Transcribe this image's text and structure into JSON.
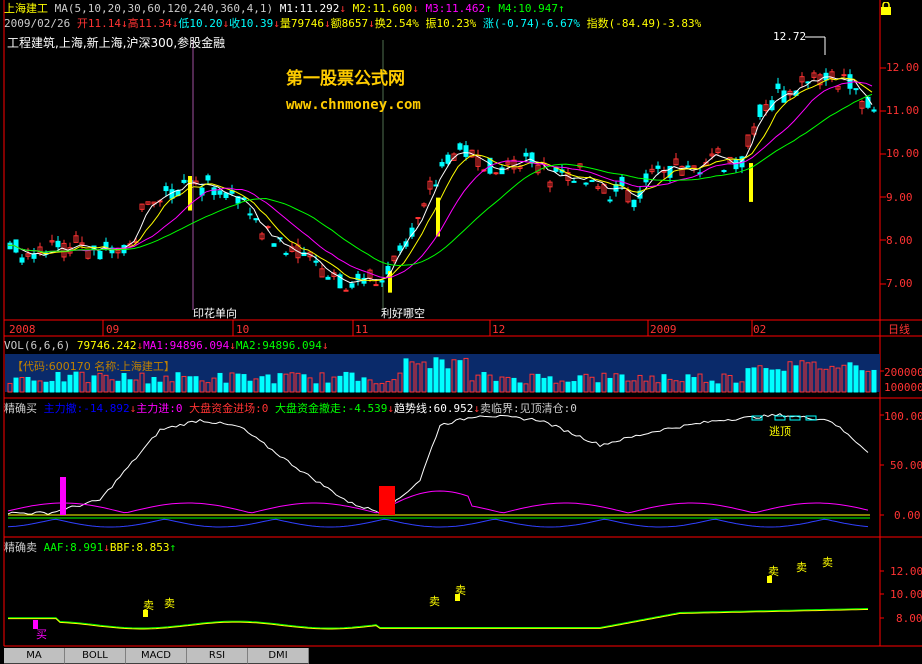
{
  "colors": {
    "up": "#ff3333",
    "down": "#00ffff",
    "ma5": "#ffffff",
    "ma10": "#ffff00",
    "ma20": "#ff00ff",
    "ma30": "#00ff00",
    "grid": "#800000",
    "axis": "#ff0000",
    "yellow": "#ffff00"
  },
  "header": {
    "stock_name": "上海建工",
    "ma_params": "MA(5,10,20,30,60,120,240,360,4,1)",
    "m1": "M1:11.292",
    "m2": "M2:11.600",
    "m3": "M3:11.462",
    "m4": "M4:10.947",
    "date": "2009/02/26",
    "open": "开11.14",
    "high": "高11.34",
    "low": "低10.20",
    "close": "收10.39",
    "volume": "量79746",
    "amount": "额8657",
    "turnover": "换2.54%",
    "amplitude": "振10.23%",
    "change": "涨(-0.74)-6.67%",
    "index": "指数(-84.49)-3.83%",
    "concepts": "工程建筑,上海,新上海,沪深300,参股金融"
  },
  "watermark": {
    "title": "第一股票公式网",
    "url": "www.chnmoney.com"
  },
  "price_panel": {
    "y_ticks": [
      "12.00",
      "11.00",
      "10.00",
      "9.00",
      "8.00",
      "7.00"
    ],
    "high_label": "12.72",
    "annotations": [
      "印花单向",
      "利好哪空"
    ],
    "x_labels": [
      "2008",
      "09",
      "10",
      "11",
      "12",
      "2009",
      "02"
    ],
    "x_corner": "日线"
  },
  "volume_panel": {
    "title": "VOL(6,6,6)",
    "vol": "79746.242",
    "ma1": "MA1:94896.094",
    "ma2": "MA2:94896.094",
    "code_box": "【代码:600170 名称:上海建工】",
    "y_ticks": [
      "200000",
      "100000"
    ]
  },
  "buy_panel": {
    "title": "精确买",
    "main_out": "主力撤:-14.892",
    "main_in": "主力进:0",
    "big_in": "大盘资金进场:0",
    "big_out": "大盘资金撤走:-4.539",
    "trend": "趋势线:60.952",
    "sell_line": "卖临界:见顶清仓:0",
    "escape_label": "逃顶",
    "y_ticks": [
      "100.00",
      "50.00",
      "0.00"
    ]
  },
  "sell_panel": {
    "title": "精确卖",
    "aaf": "AAF:8.991",
    "bbf": "BBF:8.853",
    "buy_label": "买",
    "sell_label": "卖",
    "y_ticks": [
      "12.00",
      "10.00",
      "8.00"
    ]
  },
  "tabs": [
    "MA",
    "BOLL",
    "MACD",
    "RSI",
    "DMI"
  ]
}
